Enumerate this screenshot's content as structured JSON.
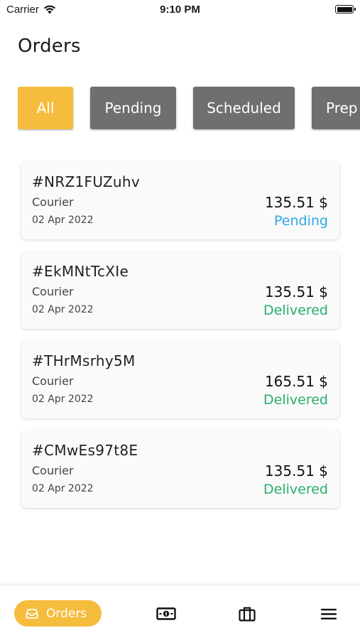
{
  "status_bar": {
    "carrier": "Carrier",
    "time": "9:10 PM"
  },
  "page": {
    "title": "Orders"
  },
  "tabs": [
    {
      "label": "All",
      "active": true
    },
    {
      "label": "Pending",
      "active": false
    },
    {
      "label": "Scheduled",
      "active": false
    },
    {
      "label": "Prep",
      "active": false
    }
  ],
  "orders": [
    {
      "id": "#NRZ1FUZuhv",
      "type": "Courier",
      "date": "02 Apr 2022",
      "price": "135.51 $",
      "status": "Pending",
      "status_color": "#2ea8e5"
    },
    {
      "id": "#EkMNtTcXIe",
      "type": "Courier",
      "date": "02 Apr 2022",
      "price": "135.51 $",
      "status": "Delivered",
      "status_color": "#26ae6c"
    },
    {
      "id": "#THrMsrhy5M",
      "type": "Courier",
      "date": "02 Apr 2022",
      "price": "165.51 $",
      "status": "Delivered",
      "status_color": "#26ae6c"
    },
    {
      "id": "#CMwEs97t8E",
      "type": "Courier",
      "date": "02 Apr 2022",
      "price": "135.51 $",
      "status": "Delivered",
      "status_color": "#26ae6c"
    }
  ],
  "bottom_nav": {
    "orders_label": "Orders",
    "items": [
      {
        "icon": "inbox-icon",
        "active": true
      },
      {
        "icon": "money-icon",
        "active": false
      },
      {
        "icon": "briefcase-icon",
        "active": false
      },
      {
        "icon": "menu-icon",
        "active": false
      }
    ]
  },
  "colors": {
    "accent": "#f6bc3d",
    "tab_inactive": "#6f6f6f",
    "pending": "#2ea8e5",
    "delivered": "#26ae6c"
  }
}
